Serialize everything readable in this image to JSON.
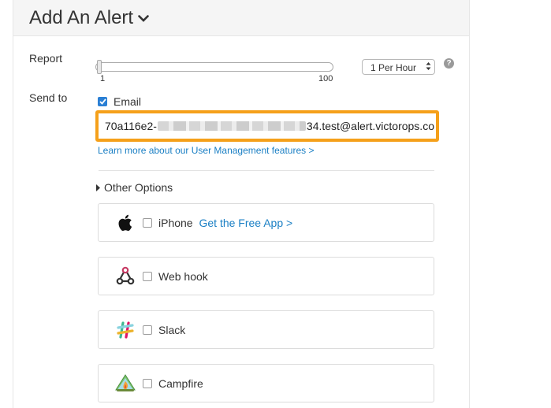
{
  "header": {
    "title": "Add An Alert"
  },
  "report": {
    "label": "Report",
    "slider_min": "1",
    "slider_max": "100",
    "slider_value": 1,
    "frequency_selected": "1 Per Hour",
    "help_glyph": "?"
  },
  "send_to": {
    "label": "Send to",
    "email_label": "Email",
    "email_checked": true,
    "email_prefix": "70a116e2-",
    "email_suffix": "34.test@alert.victorops.co",
    "learn_more": "Learn more about our User Management features >"
  },
  "other_options": {
    "label": "Other Options",
    "items": [
      {
        "icon": "apple-icon",
        "label": "iPhone",
        "link": "Get the Free App >",
        "checked": false
      },
      {
        "icon": "webhook-icon",
        "label": "Web hook",
        "checked": false
      },
      {
        "icon": "slack-icon",
        "label": "Slack",
        "checked": false
      },
      {
        "icon": "campfire-icon",
        "label": "Campfire",
        "checked": false
      }
    ]
  },
  "colors": {
    "highlight": "#f5a01a",
    "link": "#1a7fc4",
    "checkbox": "#2a7fd4"
  }
}
